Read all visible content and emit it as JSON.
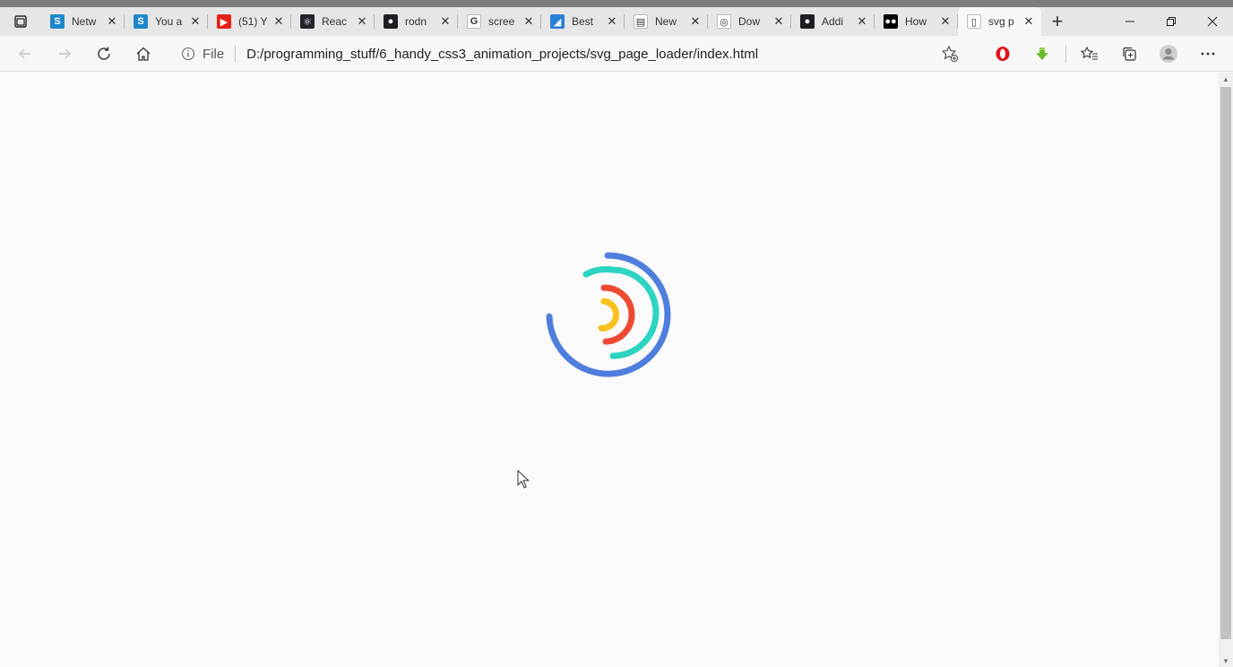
{
  "tabs": [
    {
      "label": "Netw",
      "icon": "s-brand-icon",
      "color": "#1e88c8",
      "glyph": "S"
    },
    {
      "label": "You a",
      "icon": "s-brand-icon",
      "color": "#1e88c8",
      "glyph": "S"
    },
    {
      "label": "(51) Y",
      "icon": "youtube-icon",
      "color": "#e62117",
      "glyph": "▶"
    },
    {
      "label": "Reac",
      "icon": "react-icon",
      "color": "#20232a",
      "glyph": "⚛"
    },
    {
      "label": "rodn",
      "icon": "github-icon",
      "color": "#1b1f23",
      "glyph": "●"
    },
    {
      "label": "scree",
      "icon": "google-icon",
      "color": "#ffffff",
      "glyph": "G"
    },
    {
      "label": "Best",
      "icon": "mountain-icon",
      "color": "#2a7fd4",
      "glyph": "◢"
    },
    {
      "label": "New",
      "icon": "calendar-icon",
      "color": "#ffffff",
      "glyph": "▤"
    },
    {
      "label": "Dow",
      "icon": "opera-red-icon",
      "color": "#ffffff",
      "glyph": "◎"
    },
    {
      "label": "Addi",
      "icon": "github-icon",
      "color": "#1b1f23",
      "glyph": "●"
    },
    {
      "label": "How",
      "icon": "medium-icon",
      "color": "#000000",
      "glyph": "●●"
    },
    {
      "label": "svg p",
      "icon": "page-icon",
      "color": "#ffffff",
      "glyph": "▯",
      "active": true
    }
  ],
  "address": {
    "scheme_label": "File",
    "url": "D:/programming_stuff/6_handy_css3_animation_projects/svg_page_loader/index.html"
  },
  "loader_colors": {
    "outer": "#4f7fdd",
    "second": "#2dd4c1",
    "third": "#ee4a32",
    "inner": "#f7c21b"
  }
}
